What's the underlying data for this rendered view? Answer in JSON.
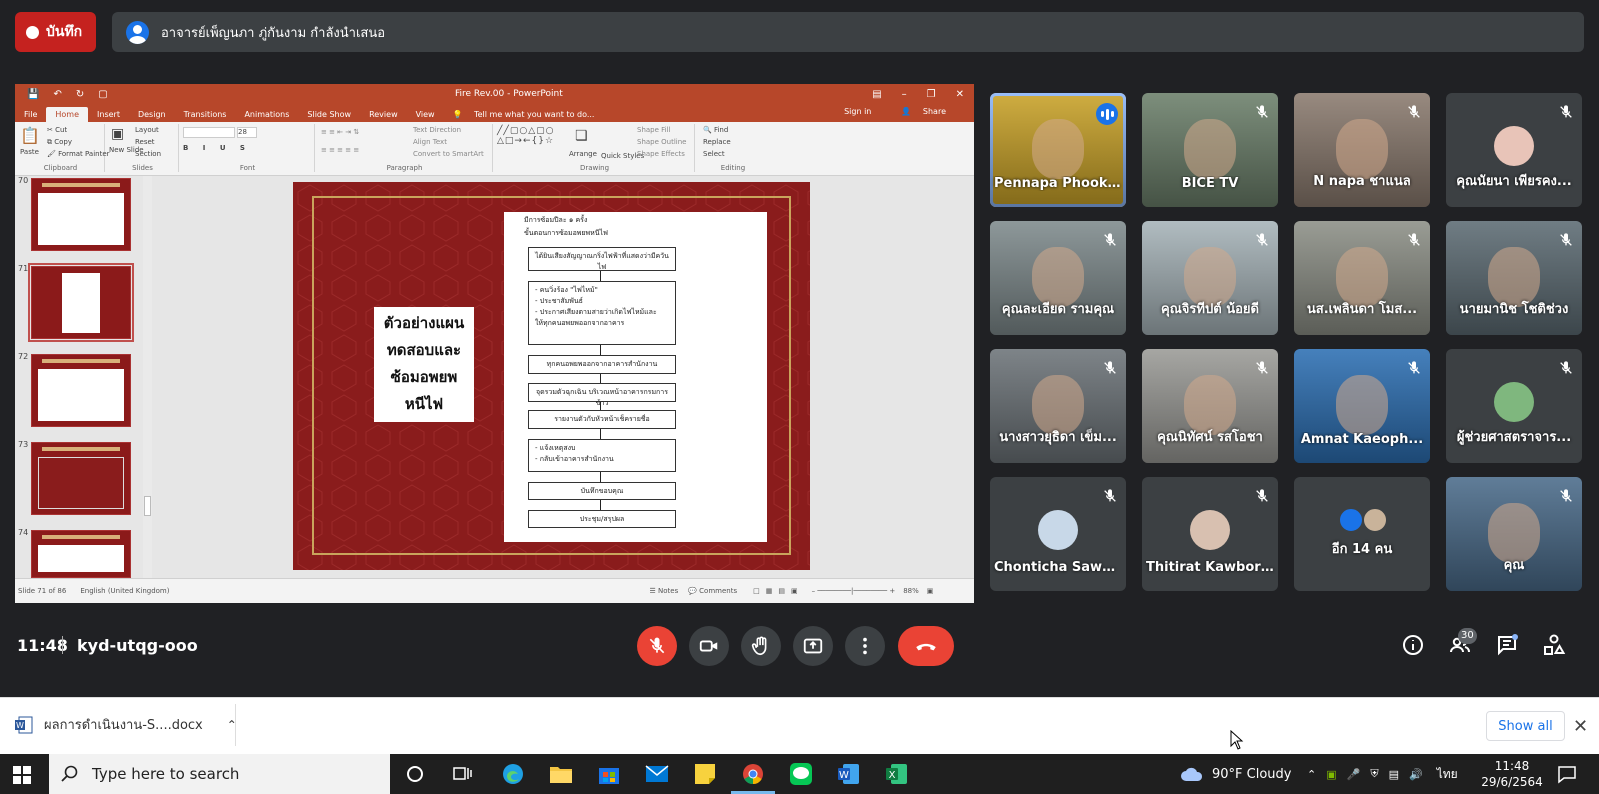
{
  "recording": {
    "label": "บันทึก"
  },
  "presenter": {
    "text": "อาจารย์เพ็ญนภา ภู่กันงาม กำลังนำเสนอ"
  },
  "ppt": {
    "window_title": "Fire Rev.00 - PowerPoint",
    "tabs": [
      "File",
      "Home",
      "Insert",
      "Design",
      "Transitions",
      "Animations",
      "Slide Show",
      "Review",
      "View"
    ],
    "active_tab": "Home",
    "tell_me": "Tell me what you want to do...",
    "sign_in": "Sign in",
    "share": "Share",
    "ribbon_groups": {
      "clipboard": "Clipboard",
      "slides": "Slides",
      "font": "Font",
      "paragraph": "Paragraph",
      "drawing": "Drawing",
      "editing": "Editing"
    },
    "ribbon_items": {
      "paste": "Paste",
      "cut": "Cut",
      "copy": "Copy",
      "format_painter": "Format Painter",
      "new_slide": "New Slide",
      "layout": "Layout",
      "reset": "Reset",
      "section": "Section",
      "text_direction": "Text Direction",
      "align_text": "Align Text",
      "convert_smartart": "Convert to SmartArt",
      "arrange": "Arrange",
      "quick_styles": "Quick Styles",
      "shape_fill": "Shape Fill",
      "shape_outline": "Shape Outline",
      "shape_effects": "Shape Effects",
      "find": "Find",
      "replace": "Replace",
      "select": "Select",
      "font_size": "28"
    },
    "slide_numbers": [
      "70",
      "71",
      "72",
      "73",
      "74"
    ],
    "selected_slide": "71",
    "slide": {
      "title_lines": [
        "ตัวอย่างแผน",
        "ทดสอบและ",
        "ซ้อมอพยพ",
        "หนีไฟ"
      ],
      "header_lines": [
        "มีการซ้อมปีละ ๑ ครั้ง",
        "ขั้นตอนการซ้อมอพยพหนีไฟ"
      ],
      "steps": [
        "ได้ยินเสียงสัญญาณกริ่งไฟฟ้าที่แสดงว่ามีควันไฟ",
        "- คนวิ่งร้อง \"ไฟไหม้\"\n- ประชาสัมพันธ์\n- ประกาศเสียงตามสายว่าเกิดไฟไหม้และ\nให้ทุกคนอพยพออกจากอาคาร",
        "ทุกคนอพยพออกจากอาคารสำนักงาน",
        "จุดรวมตัวฉุกเฉิน บริเวณหน้าอาคารกรมการข้าว",
        "รายงานตัวกับหัวหน้าเช็ครายชื่อ",
        "- แจ้งเหตุสงบ\n- กลับเข้าอาคารสำนักงาน",
        "บันทึกขอบคุณ",
        "ประชุม/สรุปผล"
      ]
    },
    "status": {
      "slide_count": "Slide 71 of 86",
      "language": "English (United Kingdom)",
      "notes": "Notes",
      "comments": "Comments",
      "zoom": "88%"
    }
  },
  "participants": [
    {
      "name": "Pennapa Phook...",
      "speaking": true
    },
    {
      "name": "BICE TV"
    },
    {
      "name": "N napa ชาแนล"
    },
    {
      "name": "คุณนัยนา เพียรคง..."
    },
    {
      "name": "คุณละเอียด รามคุณ"
    },
    {
      "name": "คุณจิรทีปต์ น้อยดี"
    },
    {
      "name": "นส.เพลินดา โมส..."
    },
    {
      "name": "นายมานิช โชติช่วง"
    },
    {
      "name": "นางสาวยุธิดา เข็ม..."
    },
    {
      "name": "คุณนิทัศน์ รสโอชา"
    },
    {
      "name": "Amnat Kaeoph..."
    },
    {
      "name": "ผู้ช่วยศาสตราจาร..."
    },
    {
      "name": "Chonticha Sawa..."
    },
    {
      "name": "Thitirat Kawbori..."
    },
    {
      "name": "อีก 14 คน"
    },
    {
      "name": "คุณ"
    }
  ],
  "meeting": {
    "time": "11:48",
    "code": "kyd-utqg-ooo",
    "participant_count": "30"
  },
  "download": {
    "filename": "ผลการดำเนินงาน-S....docx",
    "show_all": "Show all"
  },
  "taskbar": {
    "search_placeholder": "Type here to search",
    "weather": "90°F  Cloudy",
    "language": "ไทย",
    "time": "11:48",
    "date": "29/6/2564"
  },
  "colors": {
    "meet_bg": "#202124",
    "recording_red": "#c5221f",
    "end_call_red": "#ea4335",
    "ppt_orange": "#b7472a",
    "slide_red": "#8a1c1c",
    "speaker_outline": "#8ab4f8"
  }
}
